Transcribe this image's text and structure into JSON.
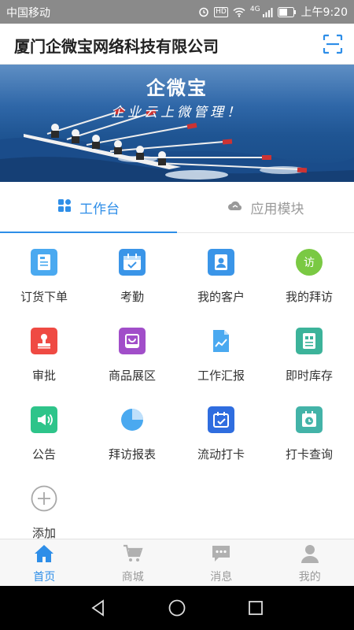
{
  "status_bar": {
    "carrier": "中国移动",
    "time": "上午9:20",
    "hd": "HD",
    "network": "4G"
  },
  "header": {
    "title": "厦门企微宝网络科技有限公司",
    "scan_icon": "scan-icon"
  },
  "banner": {
    "logo_text": "企微宝",
    "slogan": "企业云上微管理！"
  },
  "tabs": [
    {
      "label": "工作台",
      "icon": "grid-icon",
      "active": true
    },
    {
      "label": "应用模块",
      "icon": "cloud-icon",
      "active": false
    }
  ],
  "grid": {
    "items": [
      {
        "label": "订货下单",
        "icon": "order-doc-icon",
        "color": "#4aa9f0"
      },
      {
        "label": "考勤",
        "icon": "calendar-check-icon",
        "color": "#3a95e8"
      },
      {
        "label": "我的客户",
        "icon": "contact-icon",
        "color": "#3a95e8"
      },
      {
        "label": "我的拜访",
        "icon": "visit-icon",
        "color": "#7ac943",
        "badge": "访"
      },
      {
        "label": "审批",
        "icon": "stamp-icon",
        "color": "#ef4a43"
      },
      {
        "label": "商品展区",
        "icon": "shopping-bag-icon",
        "color": "#a14ec9"
      },
      {
        "label": "工作汇报",
        "icon": "report-chart-icon",
        "color": "#4aa9f0"
      },
      {
        "label": "即时库存",
        "icon": "inventory-icon",
        "color": "#3cb39a"
      },
      {
        "label": "公告",
        "icon": "megaphone-icon",
        "color": "#2ec48a"
      },
      {
        "label": "拜访报表",
        "icon": "pie-chart-icon",
        "color": "#4aa9f0"
      },
      {
        "label": "流动打卡",
        "icon": "calendar-punch-icon",
        "color": "#2f6ddf"
      },
      {
        "label": "打卡查询",
        "icon": "clock-calendar-icon",
        "color": "#43b3a8"
      },
      {
        "label": "添加",
        "icon": "add-icon",
        "color": "#9a9a9a"
      }
    ]
  },
  "bottom_nav": [
    {
      "label": "首页",
      "icon": "home-icon",
      "active": true
    },
    {
      "label": "商城",
      "icon": "cart-icon",
      "active": false
    },
    {
      "label": "消息",
      "icon": "message-icon",
      "active": false
    },
    {
      "label": "我的",
      "icon": "user-icon",
      "active": false
    }
  ],
  "system_nav": [
    "back-icon",
    "home-circle-icon",
    "recents-icon"
  ],
  "colors": {
    "accent": "#2e8ee8",
    "status_bar": "#8a8a8a",
    "inactive": "#9a9a9a"
  }
}
